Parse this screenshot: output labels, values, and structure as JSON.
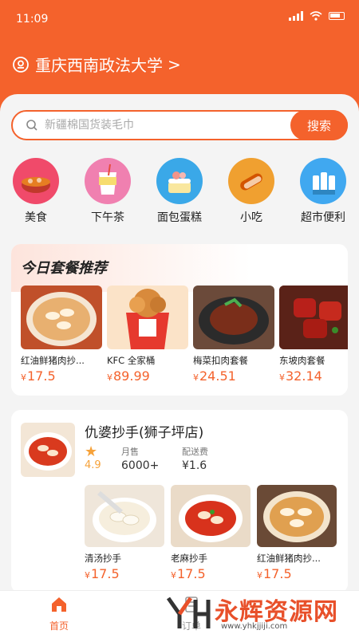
{
  "status_bar": {
    "time": "11:09"
  },
  "header": {
    "location": "重庆西南政法大学",
    "location_arrow": ">"
  },
  "search": {
    "placeholder": "新疆棉国货装毛巾",
    "button_label": "搜索"
  },
  "categories": [
    {
      "label": "美食",
      "icon": "food-bowl-icon"
    },
    {
      "label": "下午茶",
      "icon": "drink-cup-icon"
    },
    {
      "label": "面包蛋糕",
      "icon": "cake-icon"
    },
    {
      "label": "小吃",
      "icon": "snack-icon"
    },
    {
      "label": "超市便利",
      "icon": "supermarket-icon"
    }
  ],
  "combo_section": {
    "title": "今日套餐推荐",
    "items": [
      {
        "name": "红油鲜猪肉抄...",
        "yen": "¥",
        "price": "17.5"
      },
      {
        "name": "KFC 全家桶",
        "yen": "¥",
        "price": "89.99"
      },
      {
        "name": "梅菜扣肉套餐",
        "yen": "¥",
        "price": "24.51"
      },
      {
        "name": "东坡肉套餐",
        "yen": "¥",
        "price": "32.14"
      }
    ]
  },
  "shop": {
    "name": "仇婆抄手(狮子坪店)",
    "rating": "4.9",
    "monthly_sales_label": "月售",
    "monthly_sales": "6000+",
    "delivery_fee_label": "配送费",
    "delivery_fee": "¥1.6",
    "dishes": [
      {
        "name": "清汤抄手",
        "yen": "¥",
        "price": "17.5"
      },
      {
        "name": "老麻抄手",
        "yen": "¥",
        "price": "17.5"
      },
      {
        "name": "红油鲜猪肉抄...",
        "yen": "¥",
        "price": "17.5"
      }
    ]
  },
  "tabbar": {
    "home_label": "首页",
    "orders_label": "订单"
  },
  "watermark": {
    "text": "永辉资源网",
    "url": "www.yhkjjiji.com"
  },
  "colors": {
    "brand": "#f4622c",
    "price": "#f4622c",
    "rating": "#f6a23a"
  }
}
